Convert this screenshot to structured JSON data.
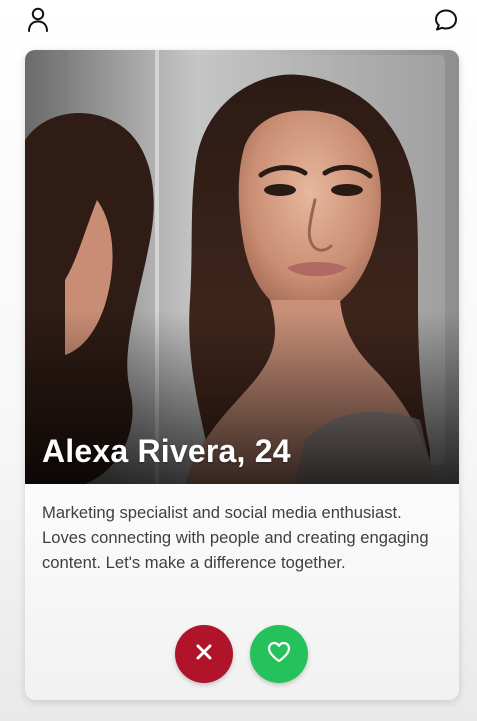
{
  "header": {
    "left_icon": "user-icon",
    "right_icon": "chat-bubble-icon"
  },
  "profile": {
    "name_age": "Alexa Rivera, 24",
    "bio": "Marketing specialist and social media enthusiast. Loves connecting with people and creating engaging content. Let's make a difference together.",
    "photo_description": "Portrait photo of a woman looking into a mirror"
  },
  "actions": {
    "dislike_icon": "x-icon",
    "like_icon": "heart-icon",
    "dislike_color": "#b0142b",
    "like_color": "#25c15a"
  }
}
